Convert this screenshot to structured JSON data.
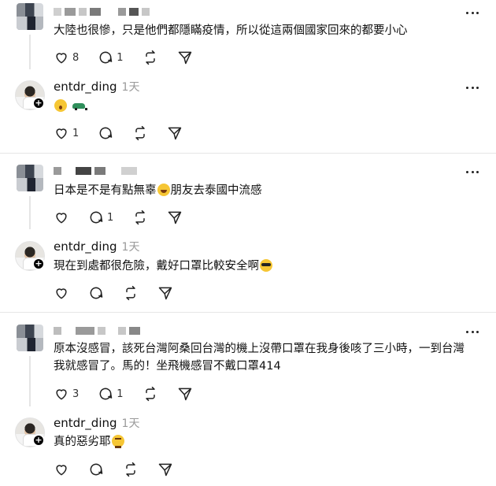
{
  "reply_author": "entdr_ding",
  "reply_time": "1天",
  "threads": [
    {
      "comment": {
        "text": "大陸也很慘，只是他們都隱瞞疫情，所以從這兩個國家回來的都要小心",
        "likes": "8",
        "replies": "1"
      },
      "reply": {
        "text": "",
        "emojis": [
          "shock-emoji",
          "car-emoji"
        ],
        "likes": "1"
      }
    },
    {
      "comment": {
        "text_before": "日本是不是有點無辜",
        "text_after": "朋友去泰國中流感",
        "likes": "",
        "replies": "1"
      },
      "reply": {
        "text": "現在到處都很危險，戴好口罩比較安全啊"
      }
    },
    {
      "comment": {
        "line1": "原本沒感冒，該死台灣阿桑回台灣的機上沒帶口罩在我身後咳了三小時，一到台灣",
        "line2": "我就感冒了。馬的！坐飛機感冒不戴口罩414",
        "likes": "3",
        "replies": "1"
      },
      "reply": {
        "text": "真的惡劣耶"
      }
    }
  ],
  "colors": {
    "divider": "#e6e6e6",
    "muted_text": "#9a9a9a"
  }
}
